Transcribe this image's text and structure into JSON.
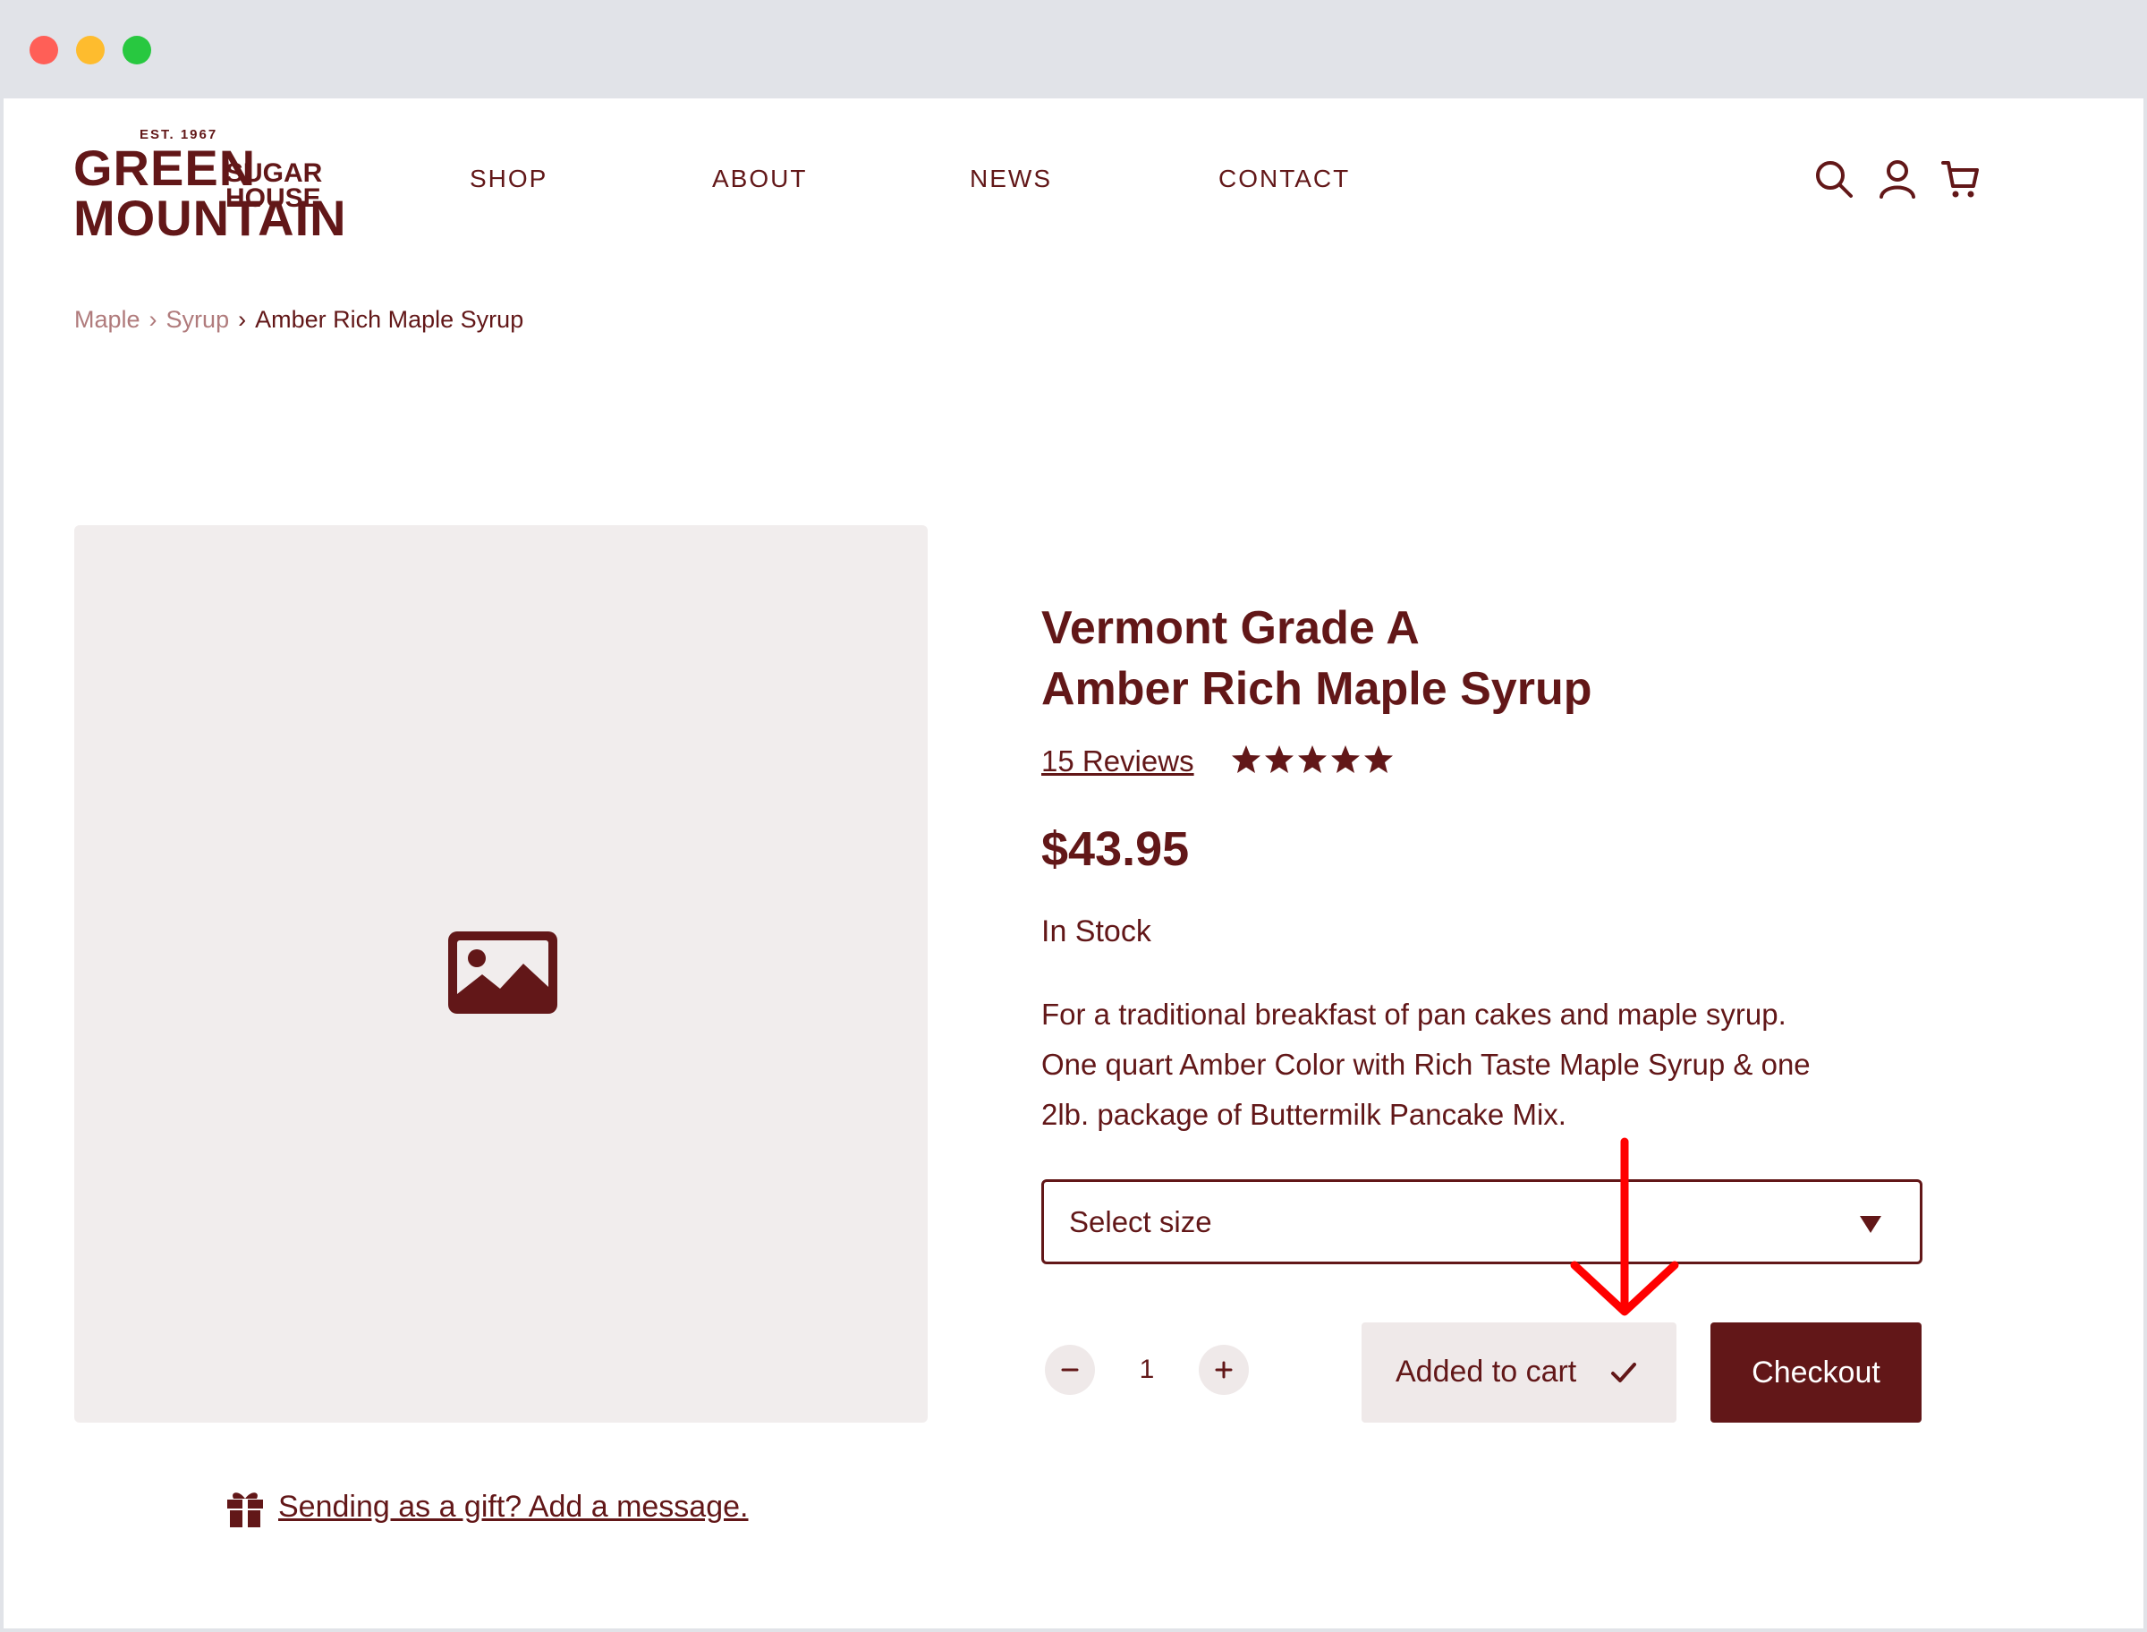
{
  "header": {
    "logo": {
      "est": "EST. 1967",
      "line1": "GREEN",
      "line2a": "SUGAR",
      "line2b": "HOUSE",
      "line3": "MOUNTAIN"
    },
    "nav": [
      {
        "label": "SHOP"
      },
      {
        "label": "ABOUT"
      },
      {
        "label": "NEWS"
      },
      {
        "label": "CONTACT"
      }
    ],
    "icons": [
      "search-icon",
      "user-icon",
      "cart-icon"
    ]
  },
  "breadcrumb": {
    "items": [
      "Maple",
      "Syrup"
    ],
    "current": "Amber Rich Maple Syrup"
  },
  "product": {
    "title_line1": "Vermont Grade A",
    "title_line2": "Amber Rich Maple Syrup",
    "reviews": "15 Reviews",
    "rating": 5,
    "rating_max": 5,
    "price": "$43.95",
    "stock": "In Stock",
    "description_lines": [
      "For a traditional breakfast of pan cakes and maple syrup.",
      "One quart Amber Color with Rich Taste Maple Syrup & one",
      "2lb. package of Buttermilk Pancake Mix."
    ],
    "size_select": {
      "value": "Select size"
    },
    "quantity": "1",
    "added_label": "Added to cart",
    "checkout_label": "Checkout"
  },
  "gift": {
    "label": "Sending as a gift?  Add a message."
  },
  "colors": {
    "brand": "#621718",
    "muted": "#b07b7c",
    "panel": "#f1eded",
    "annotation": "#ff0000"
  }
}
